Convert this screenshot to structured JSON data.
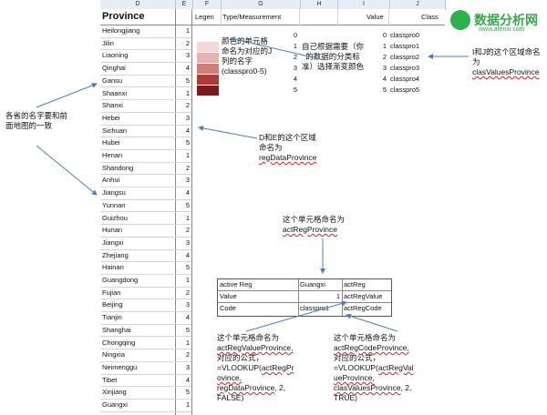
{
  "columns": [
    "D",
    "E",
    "F",
    "G",
    "H",
    "I",
    "J"
  ],
  "headers": {
    "province": "Province",
    "legend": "Legen",
    "type": "Type/Measurement",
    "value": "Value",
    "class": "Class"
  },
  "provinces": [
    {
      "name": "Heilongjiang",
      "value": "1"
    },
    {
      "name": "Jilin",
      "value": "2"
    },
    {
      "name": "Liaoning",
      "value": "3"
    },
    {
      "name": "Qinghai",
      "value": "4"
    },
    {
      "name": "Gansu",
      "value": "5"
    },
    {
      "name": "Shaanxi",
      "value": "1"
    },
    {
      "name": "Shanxi",
      "value": "2"
    },
    {
      "name": "Hebei",
      "value": "3"
    },
    {
      "name": "Sichuan",
      "value": "4"
    },
    {
      "name": "Hubei",
      "value": "5"
    },
    {
      "name": "Henan",
      "value": "1"
    },
    {
      "name": "Shandong",
      "value": "2"
    },
    {
      "name": "Anhui",
      "value": "3"
    },
    {
      "name": "Jiangsu",
      "value": "4"
    },
    {
      "name": "Yunnan",
      "value": "5"
    },
    {
      "name": "Guizhou",
      "value": "1"
    },
    {
      "name": "Hunan",
      "value": "2"
    },
    {
      "name": "Jiangxi",
      "value": "3"
    },
    {
      "name": "Zhejiang",
      "value": "4"
    },
    {
      "name": "Hainan",
      "value": "5"
    },
    {
      "name": "Guangdong",
      "value": "1"
    },
    {
      "name": "Fujian",
      "value": "2"
    },
    {
      "name": "Beijing",
      "value": "3"
    },
    {
      "name": "Tianjin",
      "value": "4"
    },
    {
      "name": "Shanghai",
      "value": "5"
    },
    {
      "name": "Chongqing",
      "value": "1"
    },
    {
      "name": "Ningxia",
      "value": "2"
    },
    {
      "name": "Neimenggu",
      "value": "3"
    },
    {
      "name": "Tibet",
      "value": "4"
    },
    {
      "name": "Xinjiang",
      "value": "5"
    },
    {
      "name": "Guangxi",
      "value": "1"
    }
  ],
  "legend_rows": [
    {
      "type": "0",
      "value": "0",
      "class": "classpro0",
      "color": "#ffffff"
    },
    {
      "type": "1",
      "value": "1",
      "class": "classpro1",
      "color": "#f2d9d7"
    },
    {
      "type": "2",
      "value": "2",
      "class": "classpro2",
      "color": "#e5b3b0"
    },
    {
      "type": "3",
      "value": "3",
      "class": "classpro3",
      "color": "#cf7e79"
    },
    {
      "type": "4",
      "value": "4",
      "class": "classpro4",
      "color": "#ad3a35"
    },
    {
      "type": "5",
      "value": "5",
      "class": "classpro5",
      "color": "#7a1a1a"
    }
  ],
  "active_table": [
    {
      "label": "active Reg",
      "value": "Guangxi",
      "name": "actReg"
    },
    {
      "label": "Value",
      "value": "1",
      "name": "actRegValue"
    },
    {
      "label": "Code",
      "value": "classpro1",
      "name": "actRegCode"
    }
  ],
  "notes": {
    "left": "各省的名字要和前面地图的一致",
    "color_names": "颜色的单元格命名为对应的J列的名字(classpro0-5)",
    "choose": "自己根据需要（你的数据的分类标准）选择渐变颜色",
    "ij": "I和J的这个区域命名为",
    "ij_name": "clasValuesProvince",
    "de": "D和E的这个区域命名为",
    "de_name": "regDataProvince",
    "act": "这个单元格命名为",
    "act_name": "actRegProvince",
    "f1_title": "这个单元格命名为",
    "f1_name": "actRegValueProvince,",
    "f1_l3": "对应的公式，",
    "f1_l4": "=VLOOKUP(",
    "f1_l4b": "actRegPr",
    "f1_l5": "ovince,",
    "f1_l6": "regDataProvince",
    "f1_l6b": ", 2,",
    "f1_l7": "FALSE)",
    "f2_title": "这个单元格命名为",
    "f2_name": "actRegCodeProvince,",
    "f2_l3": "对应的公式，",
    "f2_l4": "=VLOOKUP(",
    "f2_l4b": "actRegVal",
    "f2_l5": "ueProvince,",
    "f2_l6": "clasValuesProvince",
    "f2_l6b": ", 2,",
    "f2_l7": "TRUE)"
  },
  "logo": {
    "text": "数据分析网",
    "url": "www.afenxi.com",
    "color": "#35a94a"
  }
}
